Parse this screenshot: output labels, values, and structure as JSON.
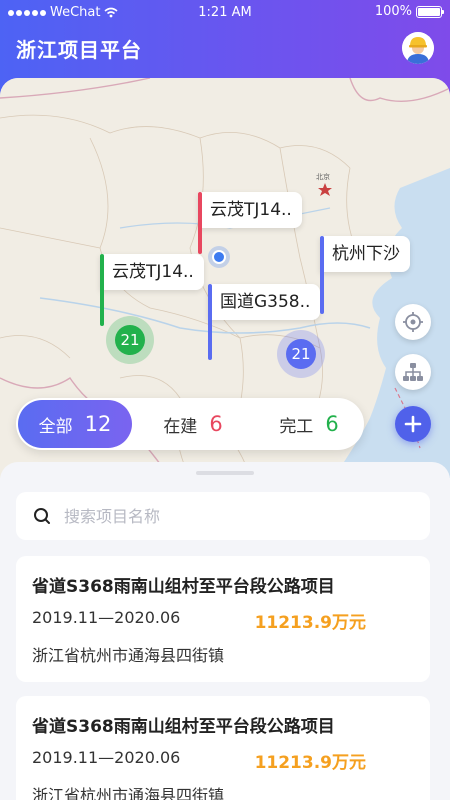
{
  "status_bar": {
    "carrier": "WeChat",
    "time": "1:21 AM",
    "battery": "100%"
  },
  "header": {
    "title": "浙江项目平台"
  },
  "map": {
    "city_label": "北京",
    "markers": [
      {
        "label": "云茂TJ14..",
        "color": "#e8475f"
      },
      {
        "label": "云茂TJ14..",
        "color": "#22b14c"
      },
      {
        "label": "国道G358..",
        "color": "#5a6cf1"
      },
      {
        "label": "杭州下沙",
        "color": "#5a6cf1"
      }
    ],
    "clusters": [
      {
        "count": "21",
        "color": "#22b14c"
      },
      {
        "count": "21",
        "color": "#5a6cf1"
      }
    ]
  },
  "filter": {
    "tabs": [
      {
        "label": "全部",
        "count": "12",
        "count_color": "#ffffff"
      },
      {
        "label": "在建",
        "count": "6",
        "count_color": "#e8475f"
      },
      {
        "label": "完工",
        "count": "6",
        "count_color": "#22b14c"
      }
    ]
  },
  "search": {
    "placeholder": "搜索项目名称"
  },
  "projects": [
    {
      "title": "省道S368雨南山组村至平台段公路项目",
      "date": "2019.11—2020.06",
      "amount": "11213.9万元",
      "address": "浙江省杭州市通海县四街镇"
    },
    {
      "title": "省道S368雨南山组村至平台段公路项目",
      "date": "2019.11—2020.06",
      "amount": "11213.9万元",
      "address": "浙江省杭州市通海县四街镇"
    }
  ],
  "colors": {
    "accent": "#5a6cf1",
    "amount": "#f5a020"
  }
}
